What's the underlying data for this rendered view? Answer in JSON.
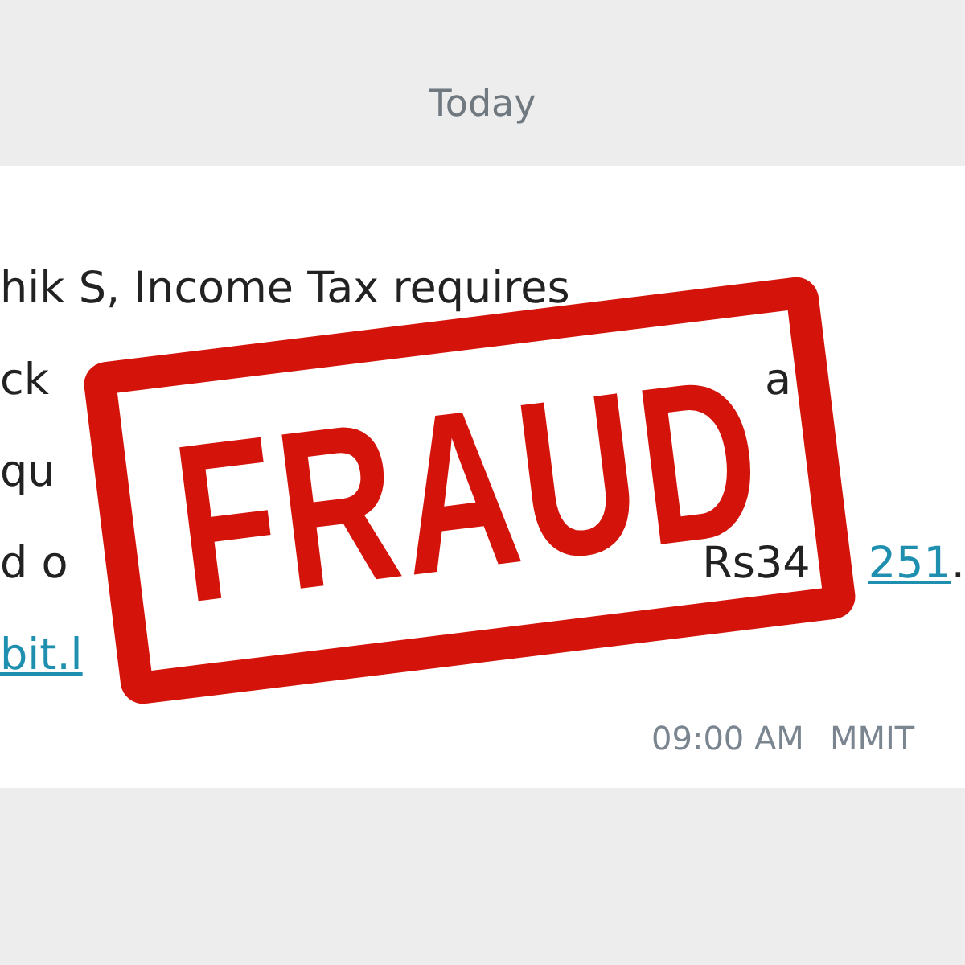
{
  "day_divider": "Today",
  "message": {
    "lines": [
      {
        "parts": [
          {
            "kind": "text",
            "text": "hik S, Income Tax requires"
          }
        ]
      },
      {
        "parts": [
          {
            "kind": "text",
            "text": "ck"
          },
          {
            "kind": "text",
            "text": "a"
          }
        ]
      },
      {
        "parts": [
          {
            "kind": "text",
            "text": "qu"
          }
        ]
      },
      {
        "parts": [
          {
            "kind": "text",
            "text": "d o"
          },
          {
            "kind": "text",
            "text": "Rs34"
          },
          {
            "kind": "link",
            "text": "251"
          },
          {
            "kind": "text",
            "text": "."
          }
        ]
      },
      {
        "parts": [
          {
            "kind": "link",
            "text": "bit.l"
          }
        ]
      }
    ],
    "time": "09:00 AM",
    "sender": "MMIT"
  },
  "stamp": {
    "text": "FRAUD"
  }
}
